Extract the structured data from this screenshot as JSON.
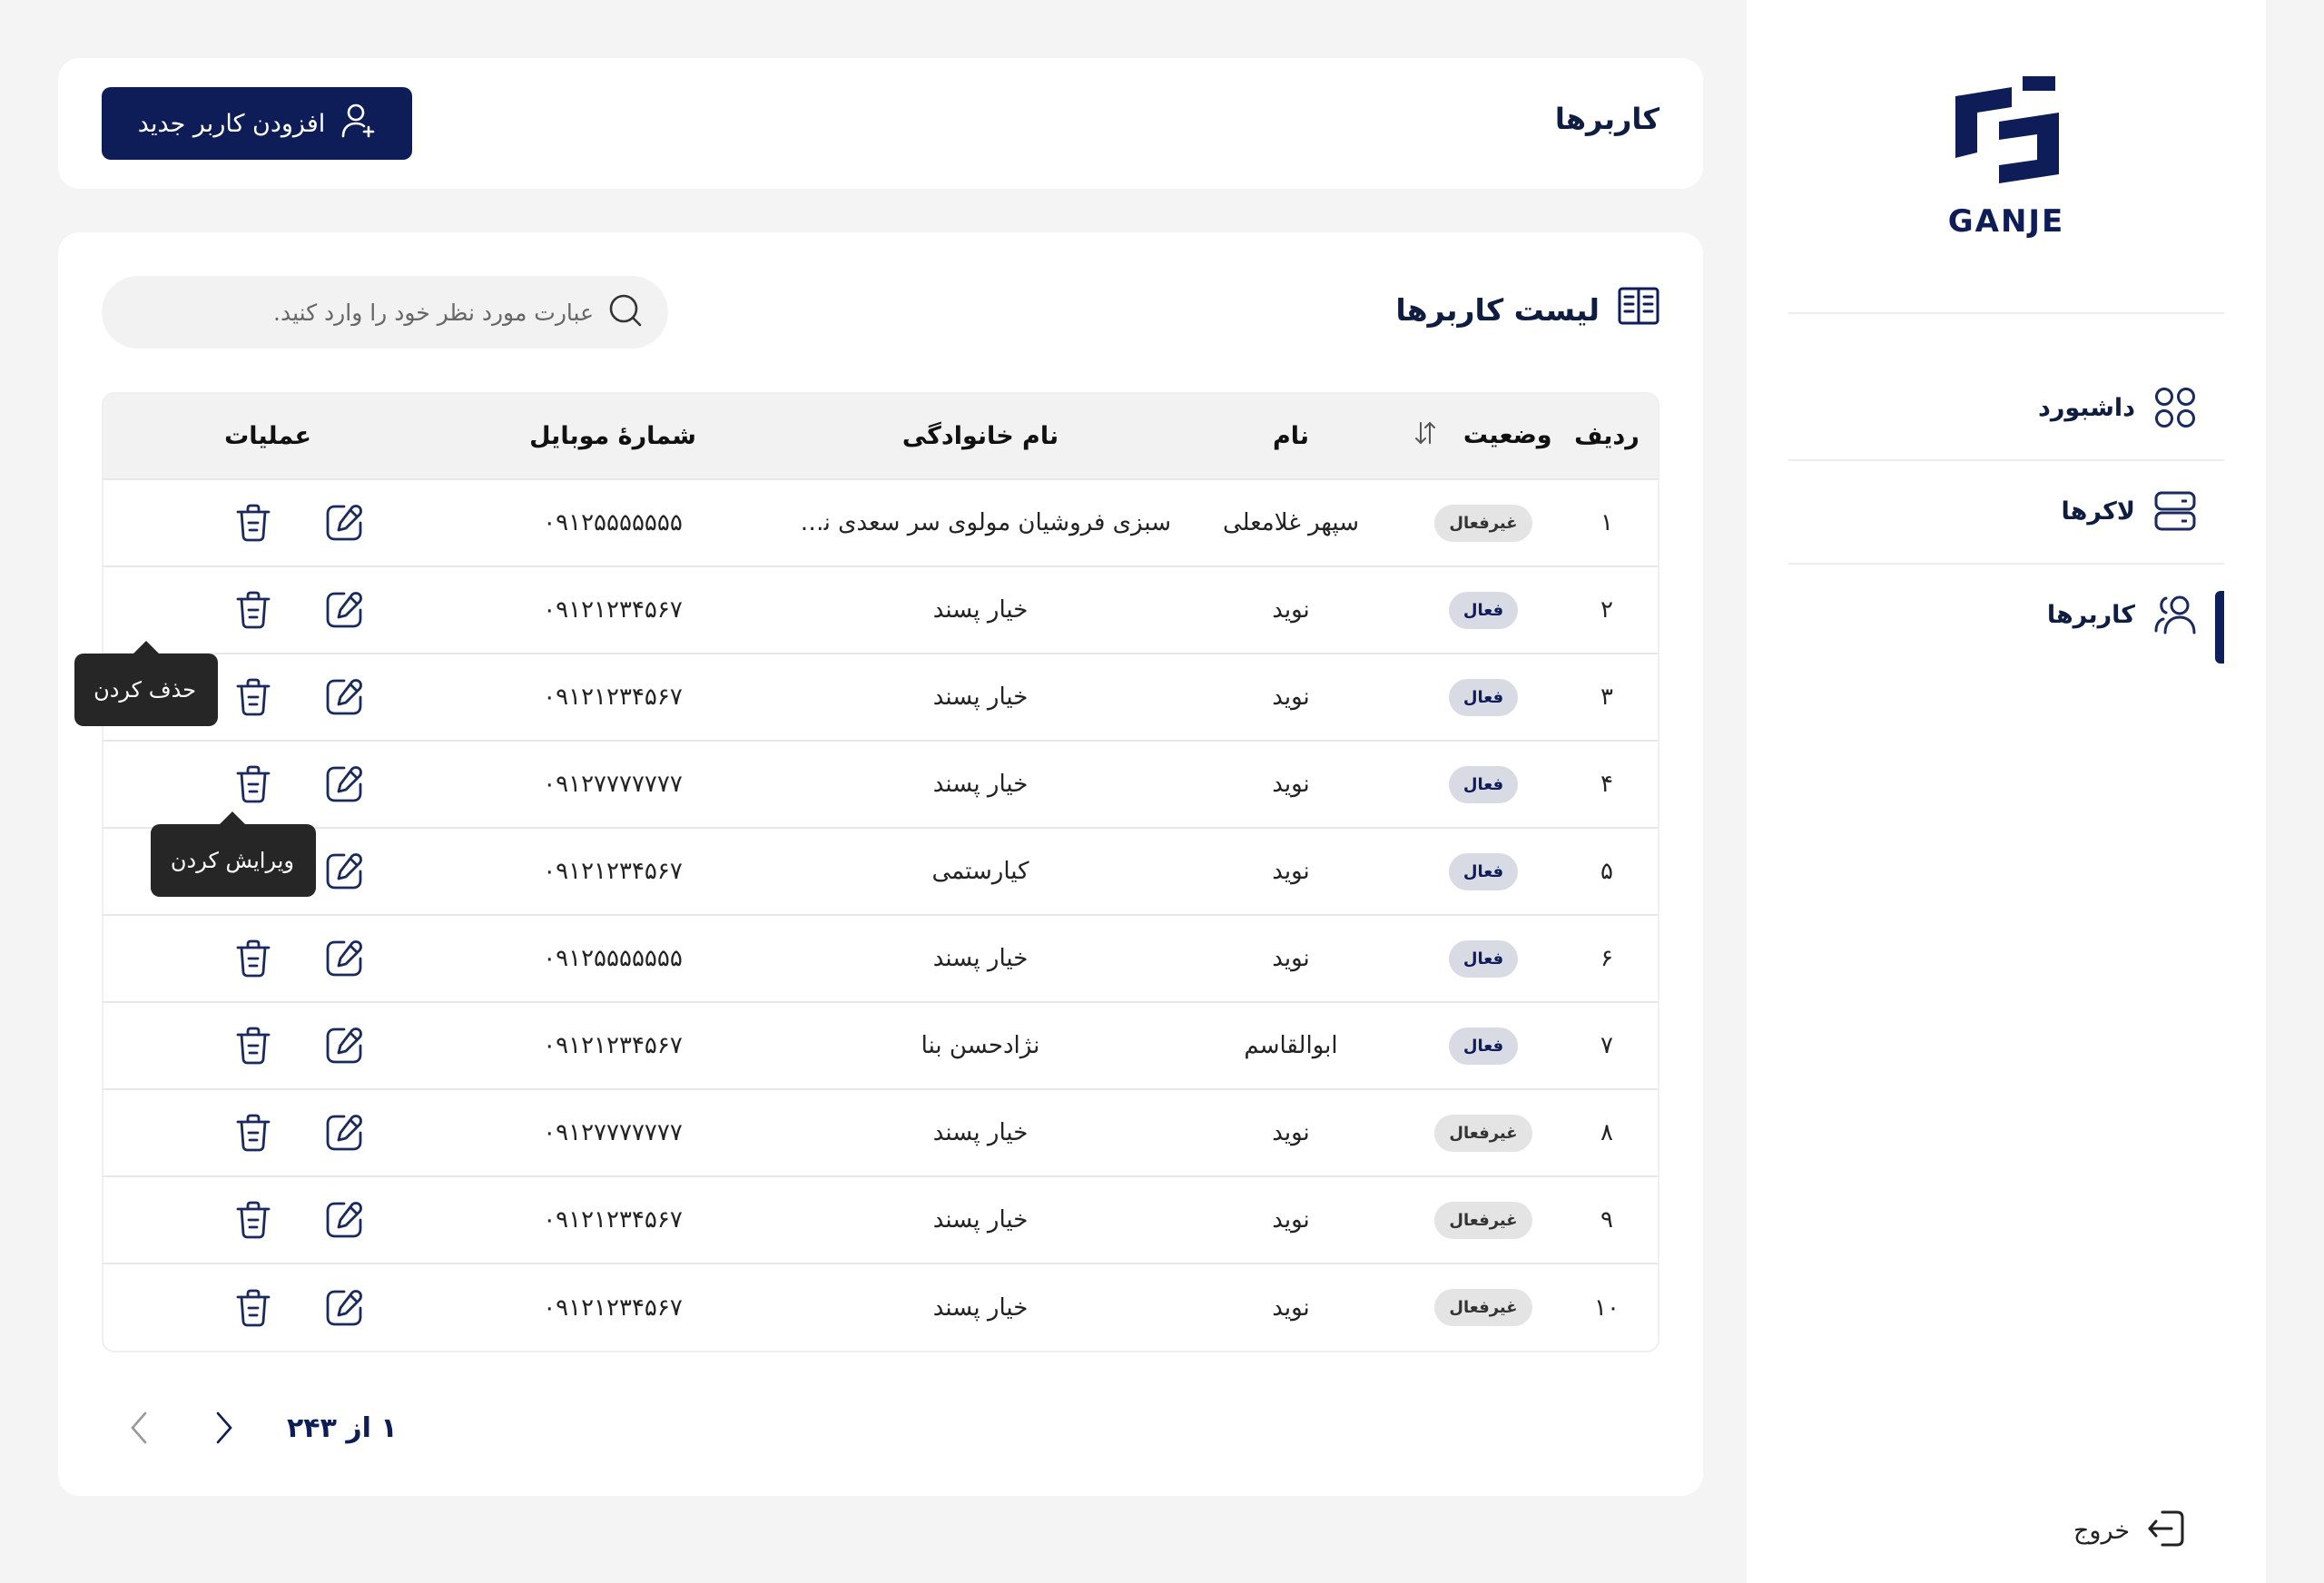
{
  "sidebar": {
    "logo_text": "GANJE",
    "items": [
      {
        "label": "داشبورد",
        "icon": "dashboard-icon",
        "active": false
      },
      {
        "label": "لاکرها",
        "icon": "lockers-icon",
        "active": false
      },
      {
        "label": "کاربرها",
        "icon": "users-icon",
        "active": true
      }
    ],
    "logout_label": "خروج"
  },
  "header": {
    "title": "کاربرها",
    "add_button_label": "افزودن کاربر جدید"
  },
  "list": {
    "title": "لیست کاربرها",
    "search_placeholder": "عبارت مورد نظر خود را وارد کنید.",
    "columns": [
      "ردیف",
      "وضعیت",
      "نام",
      "نام خانوادگی",
      "شمارهٔ موبایل",
      "عملیات"
    ],
    "rows": [
      {
        "index": "۱",
        "status": "غیرفعال",
        "status_type": "inactive",
        "first_name": "سپهر غلامعلی",
        "last_name": "سبزی فروشیان مولوی سر سعدی نرس...",
        "mobile": "۰۹۱۲۵۵۵۵۵۵۵"
      },
      {
        "index": "۲",
        "status": "فعال",
        "status_type": "active",
        "first_name": "نوید",
        "last_name": "خیار پسند",
        "mobile": "۰۹۱۲۱۲۳۴۵۶۷"
      },
      {
        "index": "۳",
        "status": "فعال",
        "status_type": "active",
        "first_name": "نوید",
        "last_name": "خیار پسند",
        "mobile": "۰۹۱۲۱۲۳۴۵۶۷"
      },
      {
        "index": "۴",
        "status": "فعال",
        "status_type": "active",
        "first_name": "نوید",
        "last_name": "خیار پسند",
        "mobile": "۰۹۱۲۷۷۷۷۷۷۷"
      },
      {
        "index": "۵",
        "status": "فعال",
        "status_type": "active",
        "first_name": "نوید",
        "last_name": "کیارستمی",
        "mobile": "۰۹۱۲۱۲۳۴۵۶۷"
      },
      {
        "index": "۶",
        "status": "فعال",
        "status_type": "active",
        "first_name": "نوید",
        "last_name": "خیار پسند",
        "mobile": "۰۹۱۲۵۵۵۵۵۵۵"
      },
      {
        "index": "۷",
        "status": "فعال",
        "status_type": "active",
        "first_name": "ابوالقاسم",
        "last_name": "نژادحسن بنا",
        "mobile": "۰۹۱۲۱۲۳۴۵۶۷"
      },
      {
        "index": "۸",
        "status": "غیرفعال",
        "status_type": "inactive",
        "first_name": "نوید",
        "last_name": "خیار پسند",
        "mobile": "۰۹۱۲۷۷۷۷۷۷۷"
      },
      {
        "index": "۹",
        "status": "غیرفعال",
        "status_type": "inactive",
        "first_name": "نوید",
        "last_name": "خیار پسند",
        "mobile": "۰۹۱۲۱۲۳۴۵۶۷"
      },
      {
        "index": "۱۰",
        "status": "غیرفعال",
        "status_type": "inactive",
        "first_name": "نوید",
        "last_name": "خیار پسند",
        "mobile": "۰۹۱۲۱۲۳۴۵۶۷"
      }
    ],
    "tooltips": {
      "delete": "حذف کردن",
      "edit": "ویرایش کردن"
    },
    "pagination": {
      "text": "۱ از ۲۴۳"
    }
  },
  "colors": {
    "brand": "#0e1d57",
    "active_badge_bg": "#d8dae4",
    "inactive_badge_bg": "#e4e4e4"
  }
}
